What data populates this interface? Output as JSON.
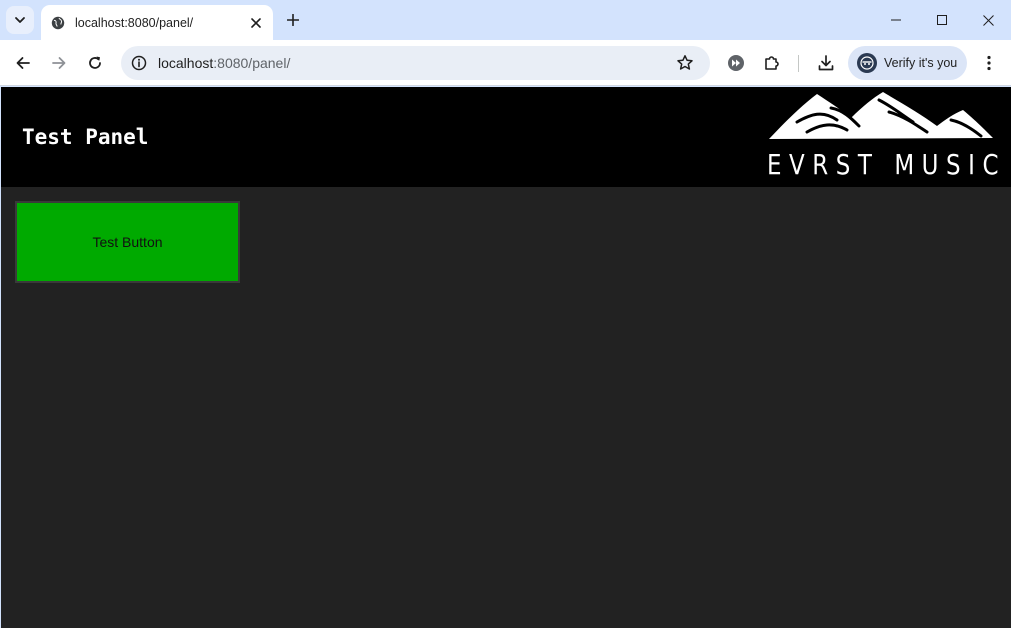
{
  "browser": {
    "tab": {
      "title": "localhost:8080/panel/"
    },
    "address_bar": {
      "url_host": "localhost",
      "url_rest": ":8080/panel/"
    },
    "profile_chip": {
      "label": "Verify it's you"
    }
  },
  "page": {
    "title": "Test Panel",
    "logo": {
      "text": "EVRST MUSIC"
    },
    "button": {
      "label": "Test Button",
      "color": "#00aa00"
    },
    "colors": {
      "header_bg": "#000000",
      "body_bg": "#222222"
    }
  }
}
